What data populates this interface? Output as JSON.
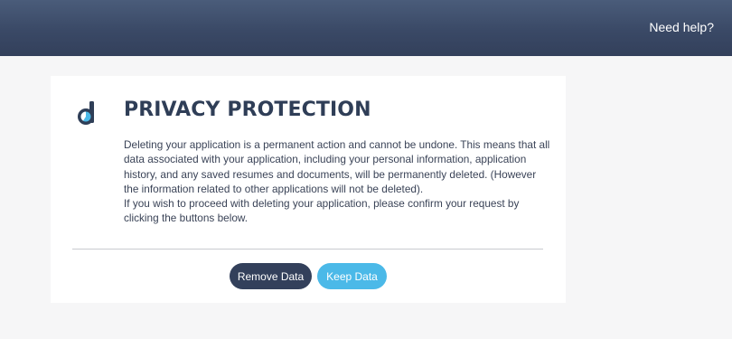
{
  "header": {
    "help_link": "Need help?"
  },
  "dialog": {
    "logo_icon": "brand-d-logo-icon",
    "title": "PRIVACY PROTECTION",
    "paragraph_1": "Deleting your application is a permanent action and cannot be undone. This means that all data associated with your application, including your personal information, application history, and any saved resumes and documents, will be permanently deleted. (However the information related to other applications will not be deleted).",
    "paragraph_2": "If you wish to proceed with deleting your application, please confirm your request by clicking the buttons below.",
    "remove_button": "Remove Data",
    "keep_button": "Keep Data"
  },
  "colors": {
    "header_bg": "#3a4966",
    "title": "#2f3e57",
    "remove_button_bg": "#33405b",
    "keep_button_bg": "#4bb9e8",
    "logo_accent": "#4bb9e8"
  }
}
